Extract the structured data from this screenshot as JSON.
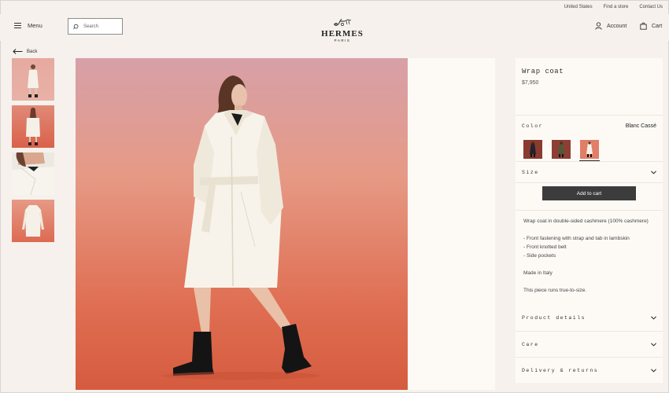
{
  "utility": {
    "country": "United States",
    "find_store": "Find a store",
    "contact": "Contact Us"
  },
  "header": {
    "menu_label": "Menu",
    "search_placeholder": "Search",
    "logo_brand": "HERMES",
    "logo_city": "PARIS",
    "account_label": "Account",
    "cart_label": "Cart"
  },
  "nav": {
    "back_label": "Back"
  },
  "product": {
    "title": "Wrap coat",
    "price": "$7,950",
    "color_label": "Color",
    "color_value": "Blanc Cassé",
    "size_label": "Size",
    "cta_label": "Add to cart",
    "description": "Wrap coat in double-sided cashmere (100% cashmere)",
    "features": [
      "- Front fastening with strap and tab in lambskin",
      "- Front knotted belt",
      "- Side pockets"
    ],
    "origin": "Made in Italy",
    "fit": "This piece runs true-to-size."
  },
  "accordions": [
    {
      "label": "Product details"
    },
    {
      "label": "Care"
    },
    {
      "label": "Delivery & returns"
    }
  ],
  "colors": {
    "accent": "#3c3c3c",
    "page_bg": "#f6f1ec",
    "panel_bg": "#fdfaf6"
  }
}
